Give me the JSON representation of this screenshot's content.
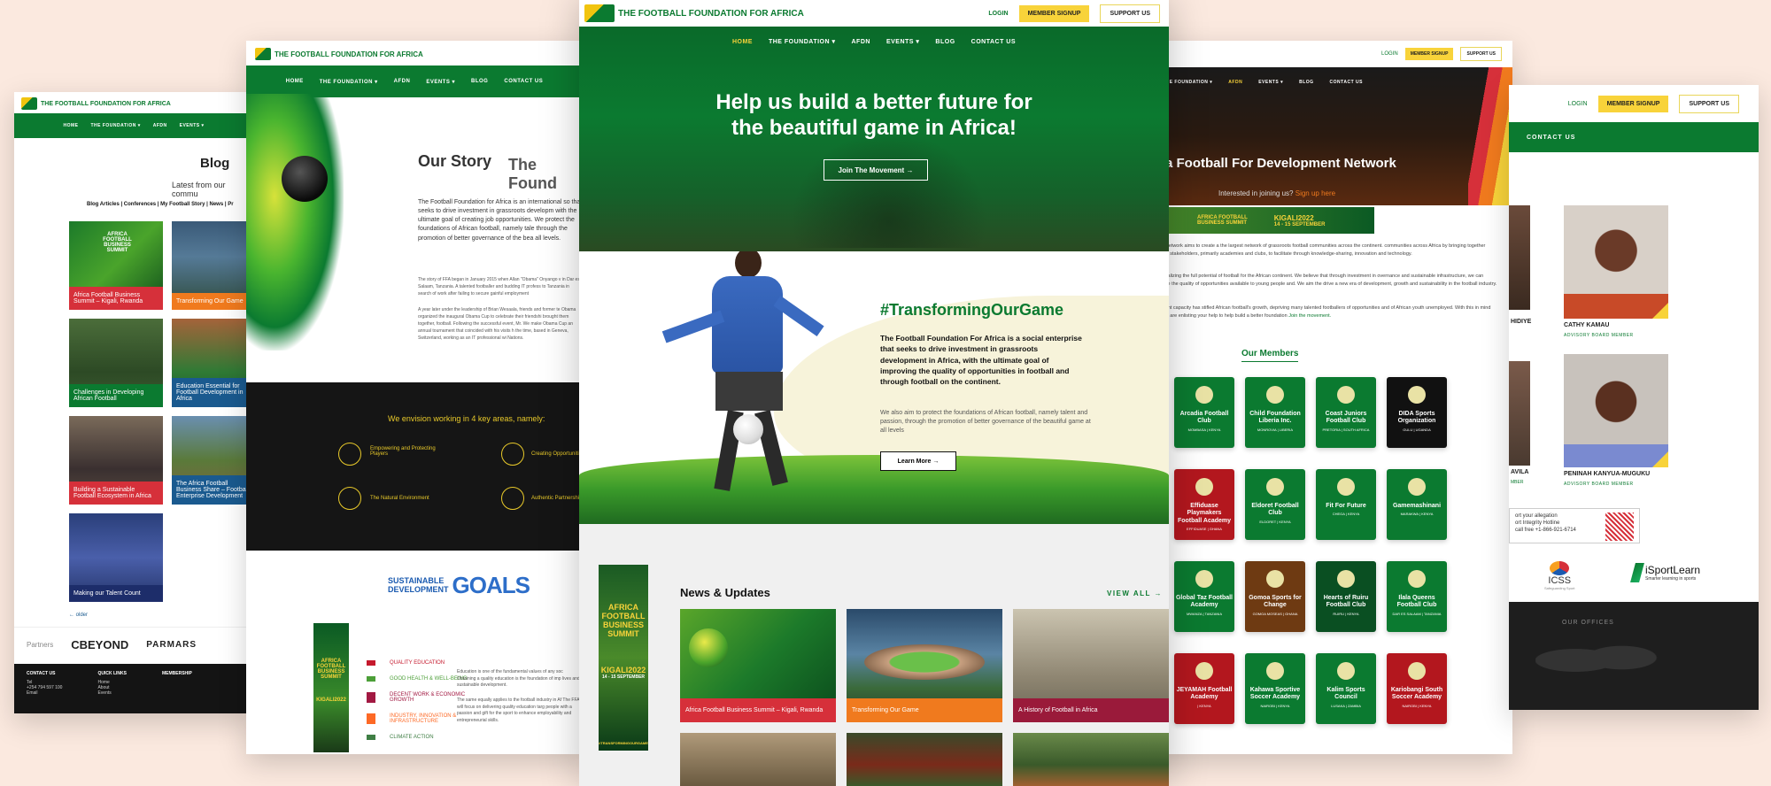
{
  "brand": {
    "name": "THE FOOTBALL FOUNDATION FOR AFRICA",
    "short": "FFA"
  },
  "colors": {
    "green": "#0b7a30",
    "yellow": "#f8d33a",
    "red": "#d6303a",
    "orange": "#f07a1e",
    "bg": "#fbe9df"
  },
  "header": {
    "login": "LOGIN",
    "member_signup": "MEMBER SIGNUP",
    "support": "SUPPORT US"
  },
  "nav": {
    "home": "HOME",
    "foundation": "THE FOUNDATION ▾",
    "afdn": "AFDN",
    "events": "EVENTS ▾",
    "blog": "BLOG",
    "contact": "CONTACT US"
  },
  "hero": {
    "title_line1": "Help us build a better future for",
    "title_line2": "the beautiful game in Africa!",
    "cta": "Join The Movement →"
  },
  "transforming": {
    "tag": "#TransformingOurGame",
    "lead": "The Football Foundation For Africa is a social enterprise that seeks to drive investment in grassroots development in Africa, with the ultimate goal of improving the quality of opportunities in football and through football on the continent.",
    "body": "We also aim to protect the foundations of African football, namely talent and passion, through the promotion of better governance of the beautiful game at all levels",
    "cta": "Learn More →"
  },
  "news": {
    "title": "News & Updates",
    "view_all": "VIEW ALL →",
    "items": [
      {
        "label": "Africa Football Business Summit – Kigali, Rwanda"
      },
      {
        "label": "Transforming Our Game"
      },
      {
        "label": "A History of Football in Africa"
      }
    ],
    "banner": {
      "l1": "AFRICA",
      "l2": "FOOTBALL",
      "l3": "BUSINESS",
      "l4": "SUMMIT",
      "year": "KIGALI2022",
      "dates": "14 - 15 SEPTEMBER",
      "hashtag": "#TRANSFORMINGOURGAME"
    }
  },
  "blog": {
    "title": "Blog",
    "subtitle": "Latest from our commu",
    "filters": "Blog Articles  |  Conferences  |  My Football Story  |  News  |  Pr",
    "posts": [
      {
        "label": "Africa Football Business Summit – Kigali, Rwanda"
      },
      {
        "label": "Transforming Our Game"
      },
      {
        "label": "Challenges in Developing African Football"
      },
      {
        "label": "Education Essential for Football Development in Africa"
      },
      {
        "label": "Building a Sustainable Football Ecosystem in Africa"
      },
      {
        "label": "The Africa Football Business Share – Football Enterprise Development"
      },
      {
        "label": "Making our Talent Count"
      }
    ],
    "older": "← older",
    "partners_label": "Partners",
    "partner1": "CBEYOND",
    "partner2": "PARMARS",
    "footer_contact": "CONTACT US",
    "footer_links": "QUICK LINKS",
    "footer_members": "MEMBERSHIP",
    "link1": "Home",
    "link2": "About",
    "link3": "Events",
    "tel": "Tel",
    "phone": "+254 794 597 100",
    "email": "Email"
  },
  "story": {
    "title": "Our Story",
    "title2": "The Found",
    "p1": "The Football Foundation for Africa is an international so that seeks to drive investment in grassroots developm with the ultimate goal of creating job opportunities. We protect the foundations of African football, namely tale through the promotion of better governance of the bea all levels.",
    "p2": "The story of FFA began in January 2015 when Allan \"Obama\" Onyango v in Dar es Salaam, Tanzania. A talented footballer and budding IT profess to Tanzania in search of work after failing to secure gainful employment",
    "p3": "A year later under the leadership of Brian Wesaala, friends and former te Obama organized the inaugural Obama Cup to celebrate their friendshi brought them together, football. Following the successful event, Mr. We make Obama Cup an annual tournament that coincided with his visits h the time, based in Geneva, Switzerland, working as an IT professional wi Nations.",
    "envision": "We envision working in 4 key areas, namely:",
    "area1": "Empowering and Protecting Players",
    "area2": "Creating Opportuniti",
    "area3": "The Natural Environment",
    "area4": "Authentic Partnershi",
    "sdg_a": "SUSTAINABLE",
    "sdg_b": "DEVELOPMENT",
    "sdg_c": "GOALS",
    "goal1": "QUALITY EDUCATION",
    "goal2": "GOOD HEALTH & WELL-BEING",
    "goal3": "DECENT WORK & ECONOMIC GROWTH",
    "goal4": "INDUSTRY, INNOVATION & INFRASTRUCTURE",
    "goal5": "CLIMATE ACTION",
    "goal_text1": "Education is one of the fundamental values of any soc Obtaining a quality education is the foundation of imp lives and sustainable development.",
    "goal_text2": "The same equally applies to the football industry in Af The FFA will focus on delivering quality education targ people with a passion and gift for the sport to enhance employability and entrepreneurial skills."
  },
  "afdn": {
    "title": "a Football For Development Network",
    "join_q": "Interested in joining us?",
    "signup": "Sign up here",
    "text1": "ment Network aims to create a the largest network of grassroots football communities across the continent. communities across Africa by bringing together football stakeholders, primarily academies and clubs, to facilitate through knowledge-sharing, innovation and technology.",
    "text2": "itian realizing the full potential of football for the African continent. We believe that through investment in overnance and sustainable infrastructure, we can improve the quality of opportunities available to young people and. We aim the drive a new era of development, growth and sustainability in the football industry.",
    "text3": "agement capacity has stifled African football's growth, depriving many talented footballers of opportunities and of African youth unemployed. With this in mind that we are enlisting your help to help build a better foundation",
    "join_link": "Join the movement.",
    "members_title": "Our Members",
    "banner_l1": "AFRICA FOOTBALL",
    "banner_l2": "BUSINESS SUMMIT",
    "banner_year": "KIGALI2022",
    "banner_dates": "14 - 15 SEPTEMBER",
    "members": [
      {
        "name": "Arcadia Football Club",
        "loc": "MOMBASA | KENYA",
        "color": "#0b7a30"
      },
      {
        "name": "Child Foundation Liberia Inc.",
        "loc": "MONROVIA | LIBERIA",
        "color": "#0b7a30"
      },
      {
        "name": "Coast Juniors Football Club",
        "loc": "PRETORIA | SOUTH AFRICA",
        "color": "#0b7a30"
      },
      {
        "name": "DIDA Sports Organization",
        "loc": "GULU | UGANDA",
        "color": "#111111"
      },
      {
        "name": "Effiduase Playmakers Football Academy",
        "loc": "EFFIDUASE | GHANA",
        "color": "#b3171e"
      },
      {
        "name": "Eldoret Football Club",
        "loc": "ELDORET | KENYA",
        "color": "#0b7a30"
      },
      {
        "name": "Fit For Future",
        "loc": "CHEGA | KENYA",
        "color": "#0b7a30"
      },
      {
        "name": "Gamemashinani",
        "loc": "MARAKWA | KENYA",
        "color": "#0b7a30"
      },
      {
        "name": "Global Taz Football Academy",
        "loc": "MWANZA | TANZANIA",
        "color": "#0b7a30"
      },
      {
        "name": "Gomoa Sports for Change",
        "loc": "GOMOA MOSEAS | GHANA",
        "color": "#6e3a12"
      },
      {
        "name": "Hearts of Ruiru Football Club",
        "loc": "RUIRU | KENYA",
        "color": "#0a4f22"
      },
      {
        "name": "Ilala Queens Football Club",
        "loc": "DAR ES SALAAM | TANZANIA",
        "color": "#0b7a30"
      },
      {
        "name": "JEYAMAH Football Academy",
        "loc": "| KENYA",
        "color": "#b3171e"
      },
      {
        "name": "Kahawa Sportive Soccer Academy",
        "loc": "NAIROBI | KENYA",
        "color": "#0b7a30"
      },
      {
        "name": "Kalim Sports Council",
        "loc": "LUSAKA | ZAMBIA",
        "color": "#0b7a30"
      },
      {
        "name": "Kariobangi South Soccer Academy",
        "loc": "NAIROBI | KENYA",
        "color": "#b3171e"
      }
    ]
  },
  "board": {
    "contact": "CONTACT US",
    "p1_name": "CATHY KAMAU",
    "p1_role": "ADVISORY BOARD MEMBER",
    "p2_name": "PENINAH KANYUA-MUGUKU",
    "p2_role": "ADVISORY BOARD MEMBER",
    "left1": "HIDIYE",
    "left2": "AVILA",
    "left3": "MBER",
    "hotline_1": "ort your allegation",
    "hotline_2": "ort Integrity Hotline",
    "hotline_3": "call free +1-866-921-6714",
    "partner1": "ICSS",
    "partner1_sub": "Safeguarding Sport",
    "partner2": "iSportLearn",
    "partner2_sub": "Smarter learning in sports",
    "offices": "OUR OFFICES"
  }
}
